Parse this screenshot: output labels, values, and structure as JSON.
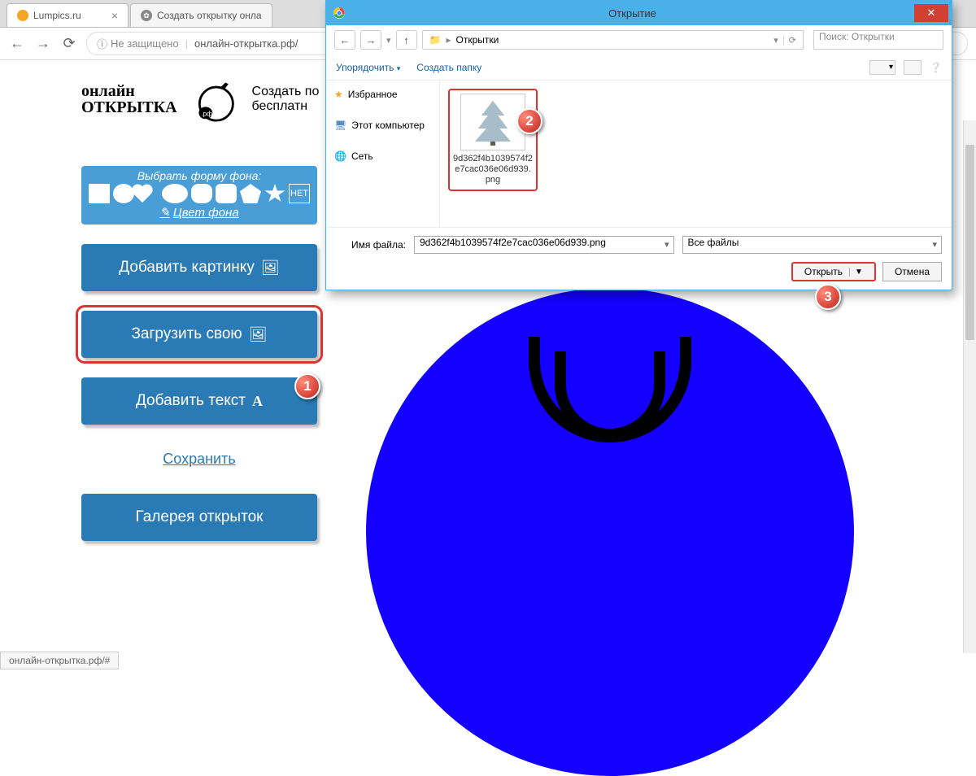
{
  "browser": {
    "tabs": [
      {
        "title": "Lumpics.ru"
      },
      {
        "title": "Создать открытку онла"
      }
    ],
    "security": "Не защищено",
    "url": "онлайн-открытка.рф/"
  },
  "logo": {
    "line1": "онлайн",
    "line2": "ОТКРЫТКА",
    "domain": ".рф",
    "desc_line1": "Создать по",
    "desc_line2": "бесплатн"
  },
  "shape_panel": {
    "title": "Выбрать форму фона:",
    "net_label": "НЕТ",
    "color_label": "Цвет фона"
  },
  "buttons": {
    "add_image": "Добавить картинку",
    "upload_own": "Загрузить свою",
    "add_text": "Добавить текст",
    "save": "Сохранить",
    "gallery": "Галерея открыток"
  },
  "status": "онлайн-открытка.рф/#",
  "dialog": {
    "title": "Открытие",
    "path_item": "Открытки",
    "search_placeholder": "Поиск: Открытки",
    "tool_organize": "Упорядочить",
    "tool_newfolder": "Создать папку",
    "side": {
      "fav": "Избранное",
      "pc": "Этот компьютер",
      "net": "Сеть"
    },
    "file": {
      "name": "9d362f4b1039574f2e7cac036e06d939.png"
    },
    "field_label": "Имя файла:",
    "field_value": "9d362f4b1039574f2e7cac036e06d939.png",
    "filter": "Все файлы",
    "open_btn": "Открыть",
    "cancel_btn": "Отмена"
  },
  "badges": {
    "b1": "1",
    "b2": "2",
    "b3": "3"
  }
}
